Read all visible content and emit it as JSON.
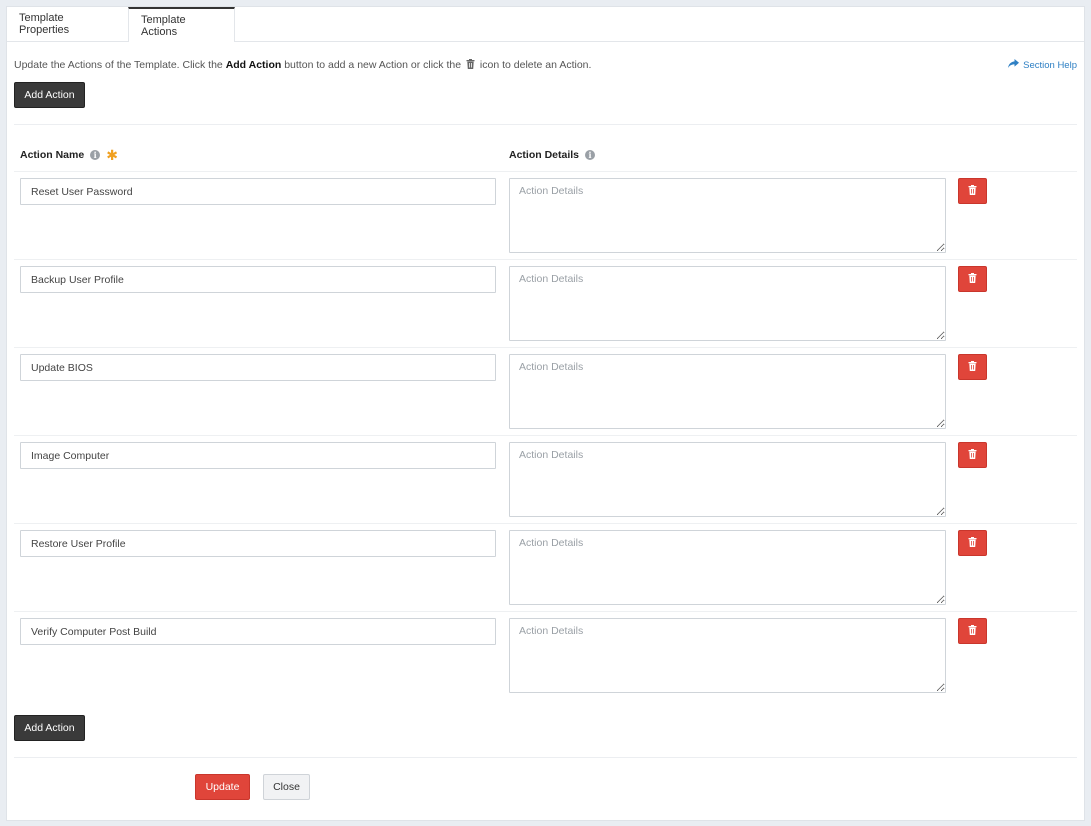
{
  "tabs": [
    {
      "label": "Template Properties"
    },
    {
      "label": "Template Actions"
    }
  ],
  "intro": {
    "before": "Update the Actions of the Template. Click the ",
    "bold": "Add Action",
    "middle": " button to add a new Action or click the ",
    "after": " icon to delete an Action."
  },
  "section_help": "Section Help",
  "add_action_label": "Add Action",
  "columns": {
    "name": "Action Name",
    "details": "Action Details"
  },
  "details_placeholder": "Action Details",
  "actions": [
    {
      "name": "Reset User Password"
    },
    {
      "name": "Backup User Profile"
    },
    {
      "name": "Update BIOS"
    },
    {
      "name": "Image Computer"
    },
    {
      "name": "Restore User Profile"
    },
    {
      "name": "Verify Computer Post Build"
    }
  ],
  "footer": {
    "update_label": "Update",
    "close_label": "Close"
  },
  "colors": {
    "danger": "#e0453a",
    "dark_button": "#3a3a3a",
    "link": "#2f80c4",
    "required": "#f0a020"
  }
}
